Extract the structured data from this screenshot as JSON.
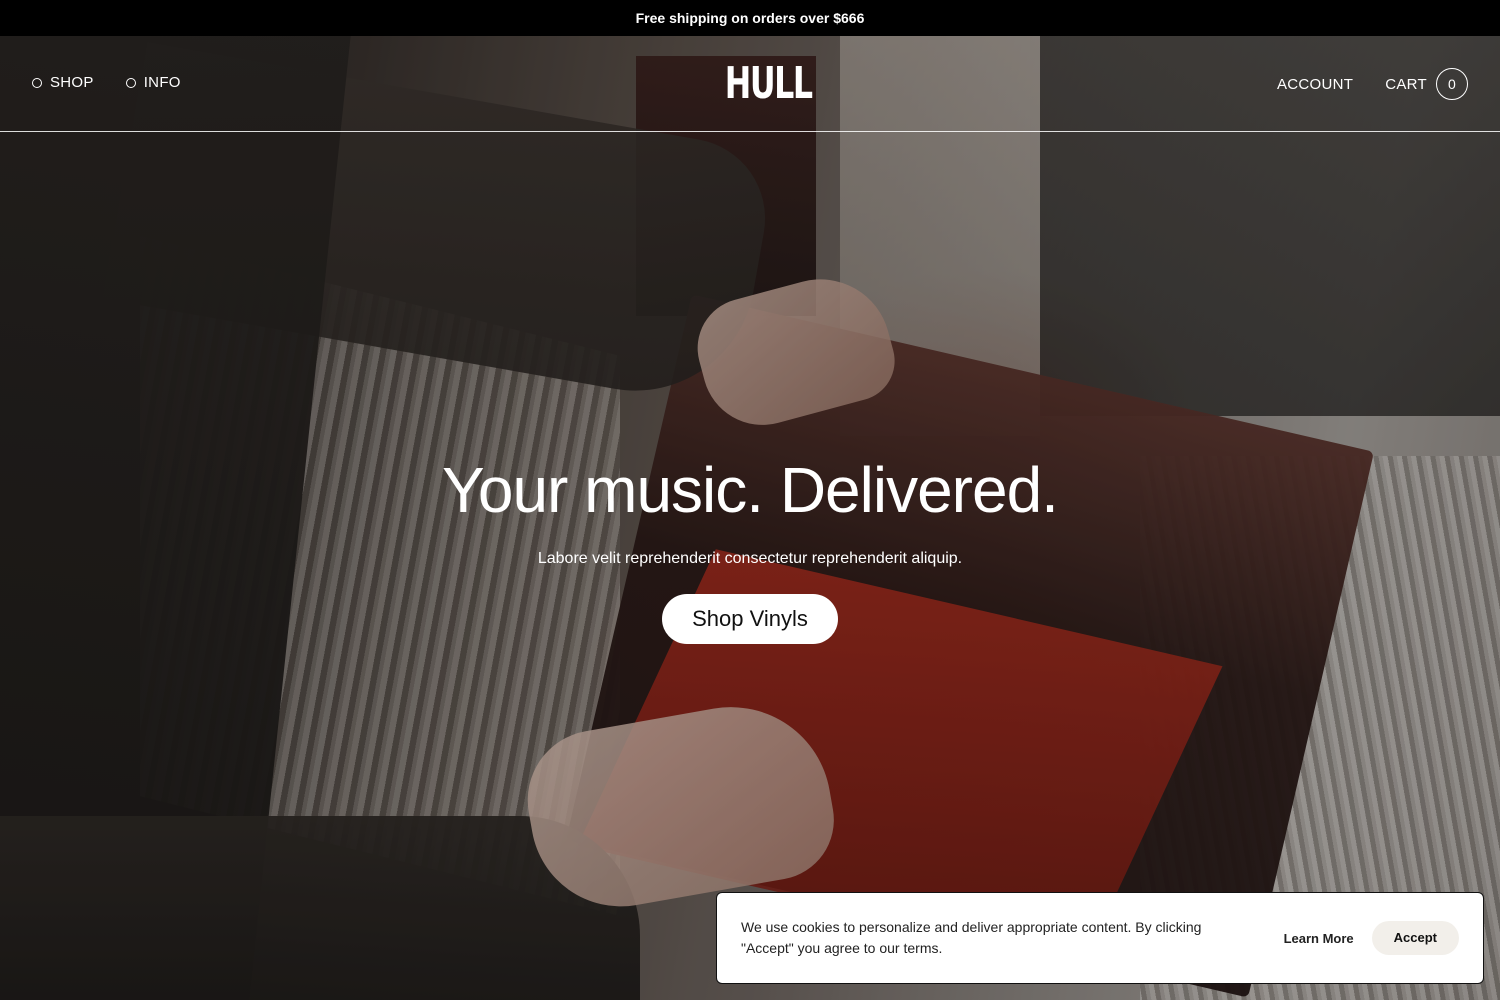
{
  "announcement": {
    "text": "Free shipping on orders over $666"
  },
  "header": {
    "nav_left": [
      {
        "label": "SHOP",
        "icon": "circle-bullet-icon"
      },
      {
        "label": "INFO",
        "icon": "circle-bullet-icon"
      }
    ],
    "logo": "HULL",
    "account_label": "ACCOUNT",
    "cart_label": "CART",
    "cart_count": "0"
  },
  "hero": {
    "title": "Your music. Delivered.",
    "subtitle": "Labore velit reprehenderit consectetur reprehenderit aliquip.",
    "cta_label": "Shop Vinyls"
  },
  "cookie_banner": {
    "text": "We use cookies to personalize and deliver appropriate content. By clicking \"Accept\" you agree to our terms.",
    "learn_more_label": "Learn More",
    "accept_label": "Accept"
  },
  "colors": {
    "announcement_bg": "#000000",
    "text_light": "#ffffff",
    "button_bg": "#ffffff",
    "accept_bg": "#f2efea"
  }
}
